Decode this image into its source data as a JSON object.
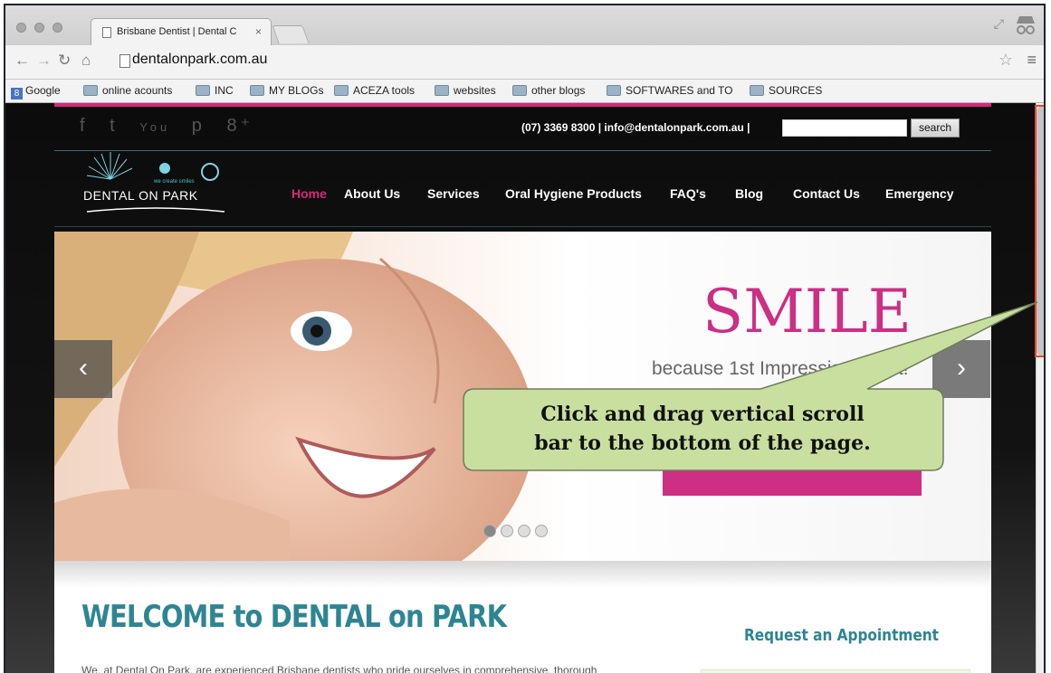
{
  "browser": {
    "tab_title": "Brisbane Dentist | Dental C",
    "tab_close": "×",
    "url": "dentalonpark.com.au",
    "bookmarks": [
      {
        "label": "Google",
        "type": "google"
      },
      {
        "label": "online acounts",
        "type": "folder"
      },
      {
        "label": "INC",
        "type": "folder"
      },
      {
        "label": "MY BLOGs",
        "type": "folder"
      },
      {
        "label": "ACEZA tools",
        "type": "folder"
      },
      {
        "label": "websites",
        "type": "folder"
      },
      {
        "label": "other blogs",
        "type": "folder"
      },
      {
        "label": "SOFTWARES and TO",
        "type": "folder"
      },
      {
        "label": "SOURCES",
        "type": "folder"
      }
    ]
  },
  "site": {
    "contact": "(07) 3369 8300  |  info@dentalonpark.com.au |",
    "search_label": "search",
    "logo_text": "DENTAL ON PARK",
    "logo_tag": "we create smiles",
    "nav": [
      "Home",
      "About Us",
      "Services",
      "Oral Hygiene Products",
      "FAQ's",
      "Blog",
      "Contact Us",
      "Emergency"
    ],
    "active_nav": "Home",
    "slide_heading": "SMILE",
    "slide_tagline": "because 1st Impressions Last!",
    "welcome": "WELCOME to DENTAL on PARK",
    "intro": "We, at Dental On Park, are experienced Brisbane dentists who pride ourselves in comprehensive, thorough",
    "appointment_title": "Request an Appointment"
  },
  "callout": {
    "line1": "Click and drag vertical scroll",
    "line2": "bar to the bottom of the page."
  },
  "colors": {
    "accent_pink": "#cc2f84",
    "teal": "#2e8592",
    "callout_fill": "#c9dfa0",
    "scroll_highlight": "#e8482b"
  }
}
